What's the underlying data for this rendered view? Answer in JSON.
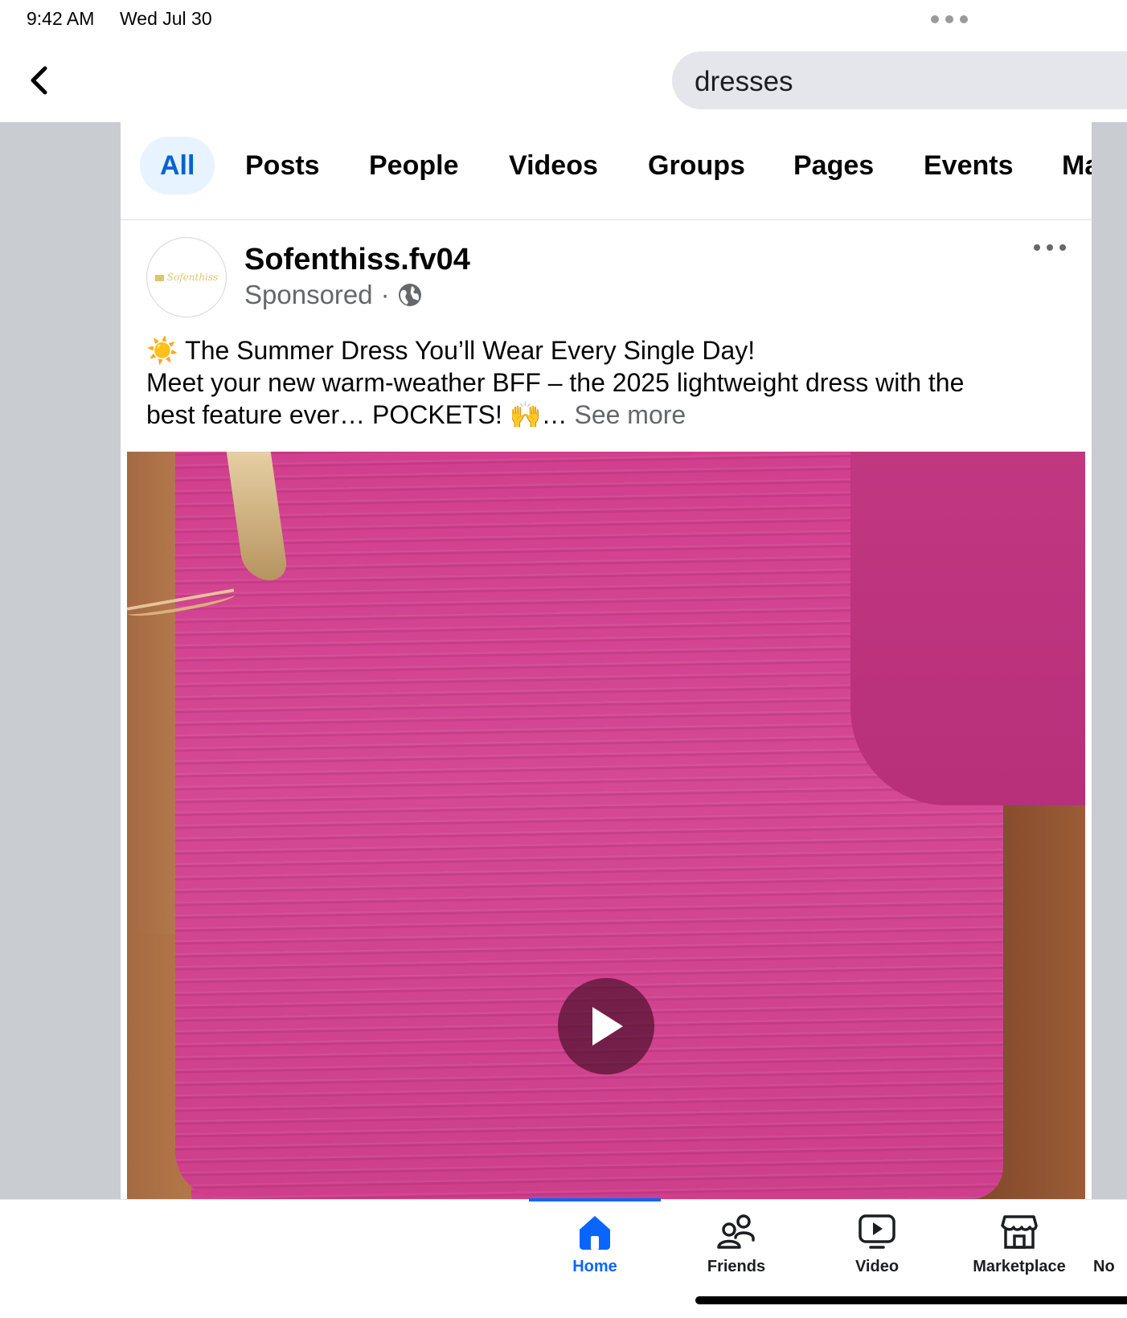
{
  "status_bar": {
    "time": "9:42 AM",
    "date": "Wed Jul 30"
  },
  "search": {
    "query": "dresses"
  },
  "tabs": [
    {
      "label": "All",
      "active": true
    },
    {
      "label": "Posts"
    },
    {
      "label": "People"
    },
    {
      "label": "Videos"
    },
    {
      "label": "Groups"
    },
    {
      "label": "Pages"
    },
    {
      "label": "Events"
    },
    {
      "label": "Ma"
    }
  ],
  "post": {
    "author": "Sofenthiss.fv04",
    "avatar_text": "Sofenthiss",
    "sponsored": "Sponsored",
    "separator": "·",
    "text_line1": "☀️ The Summer Dress You’ll Wear Every Single Day!",
    "text_line2": "Meet your new warm-weather BFF – the 2025 lightweight dress with the",
    "text_line3": "best feature ever… POCKETS! 🙌…",
    "see_more": "See more"
  },
  "bottom_nav": [
    {
      "label": "Home",
      "icon": "home-icon",
      "active": true
    },
    {
      "label": "Friends",
      "icon": "friends-icon"
    },
    {
      "label": "Video",
      "icon": "video-icon"
    },
    {
      "label": "Marketplace",
      "icon": "marketplace-icon"
    },
    {
      "label": "No",
      "icon": "notifications-icon"
    }
  ],
  "colors": {
    "accent": "#0866ff",
    "tab_active_bg": "#e7f3ff",
    "media_pink": "#d24591"
  }
}
